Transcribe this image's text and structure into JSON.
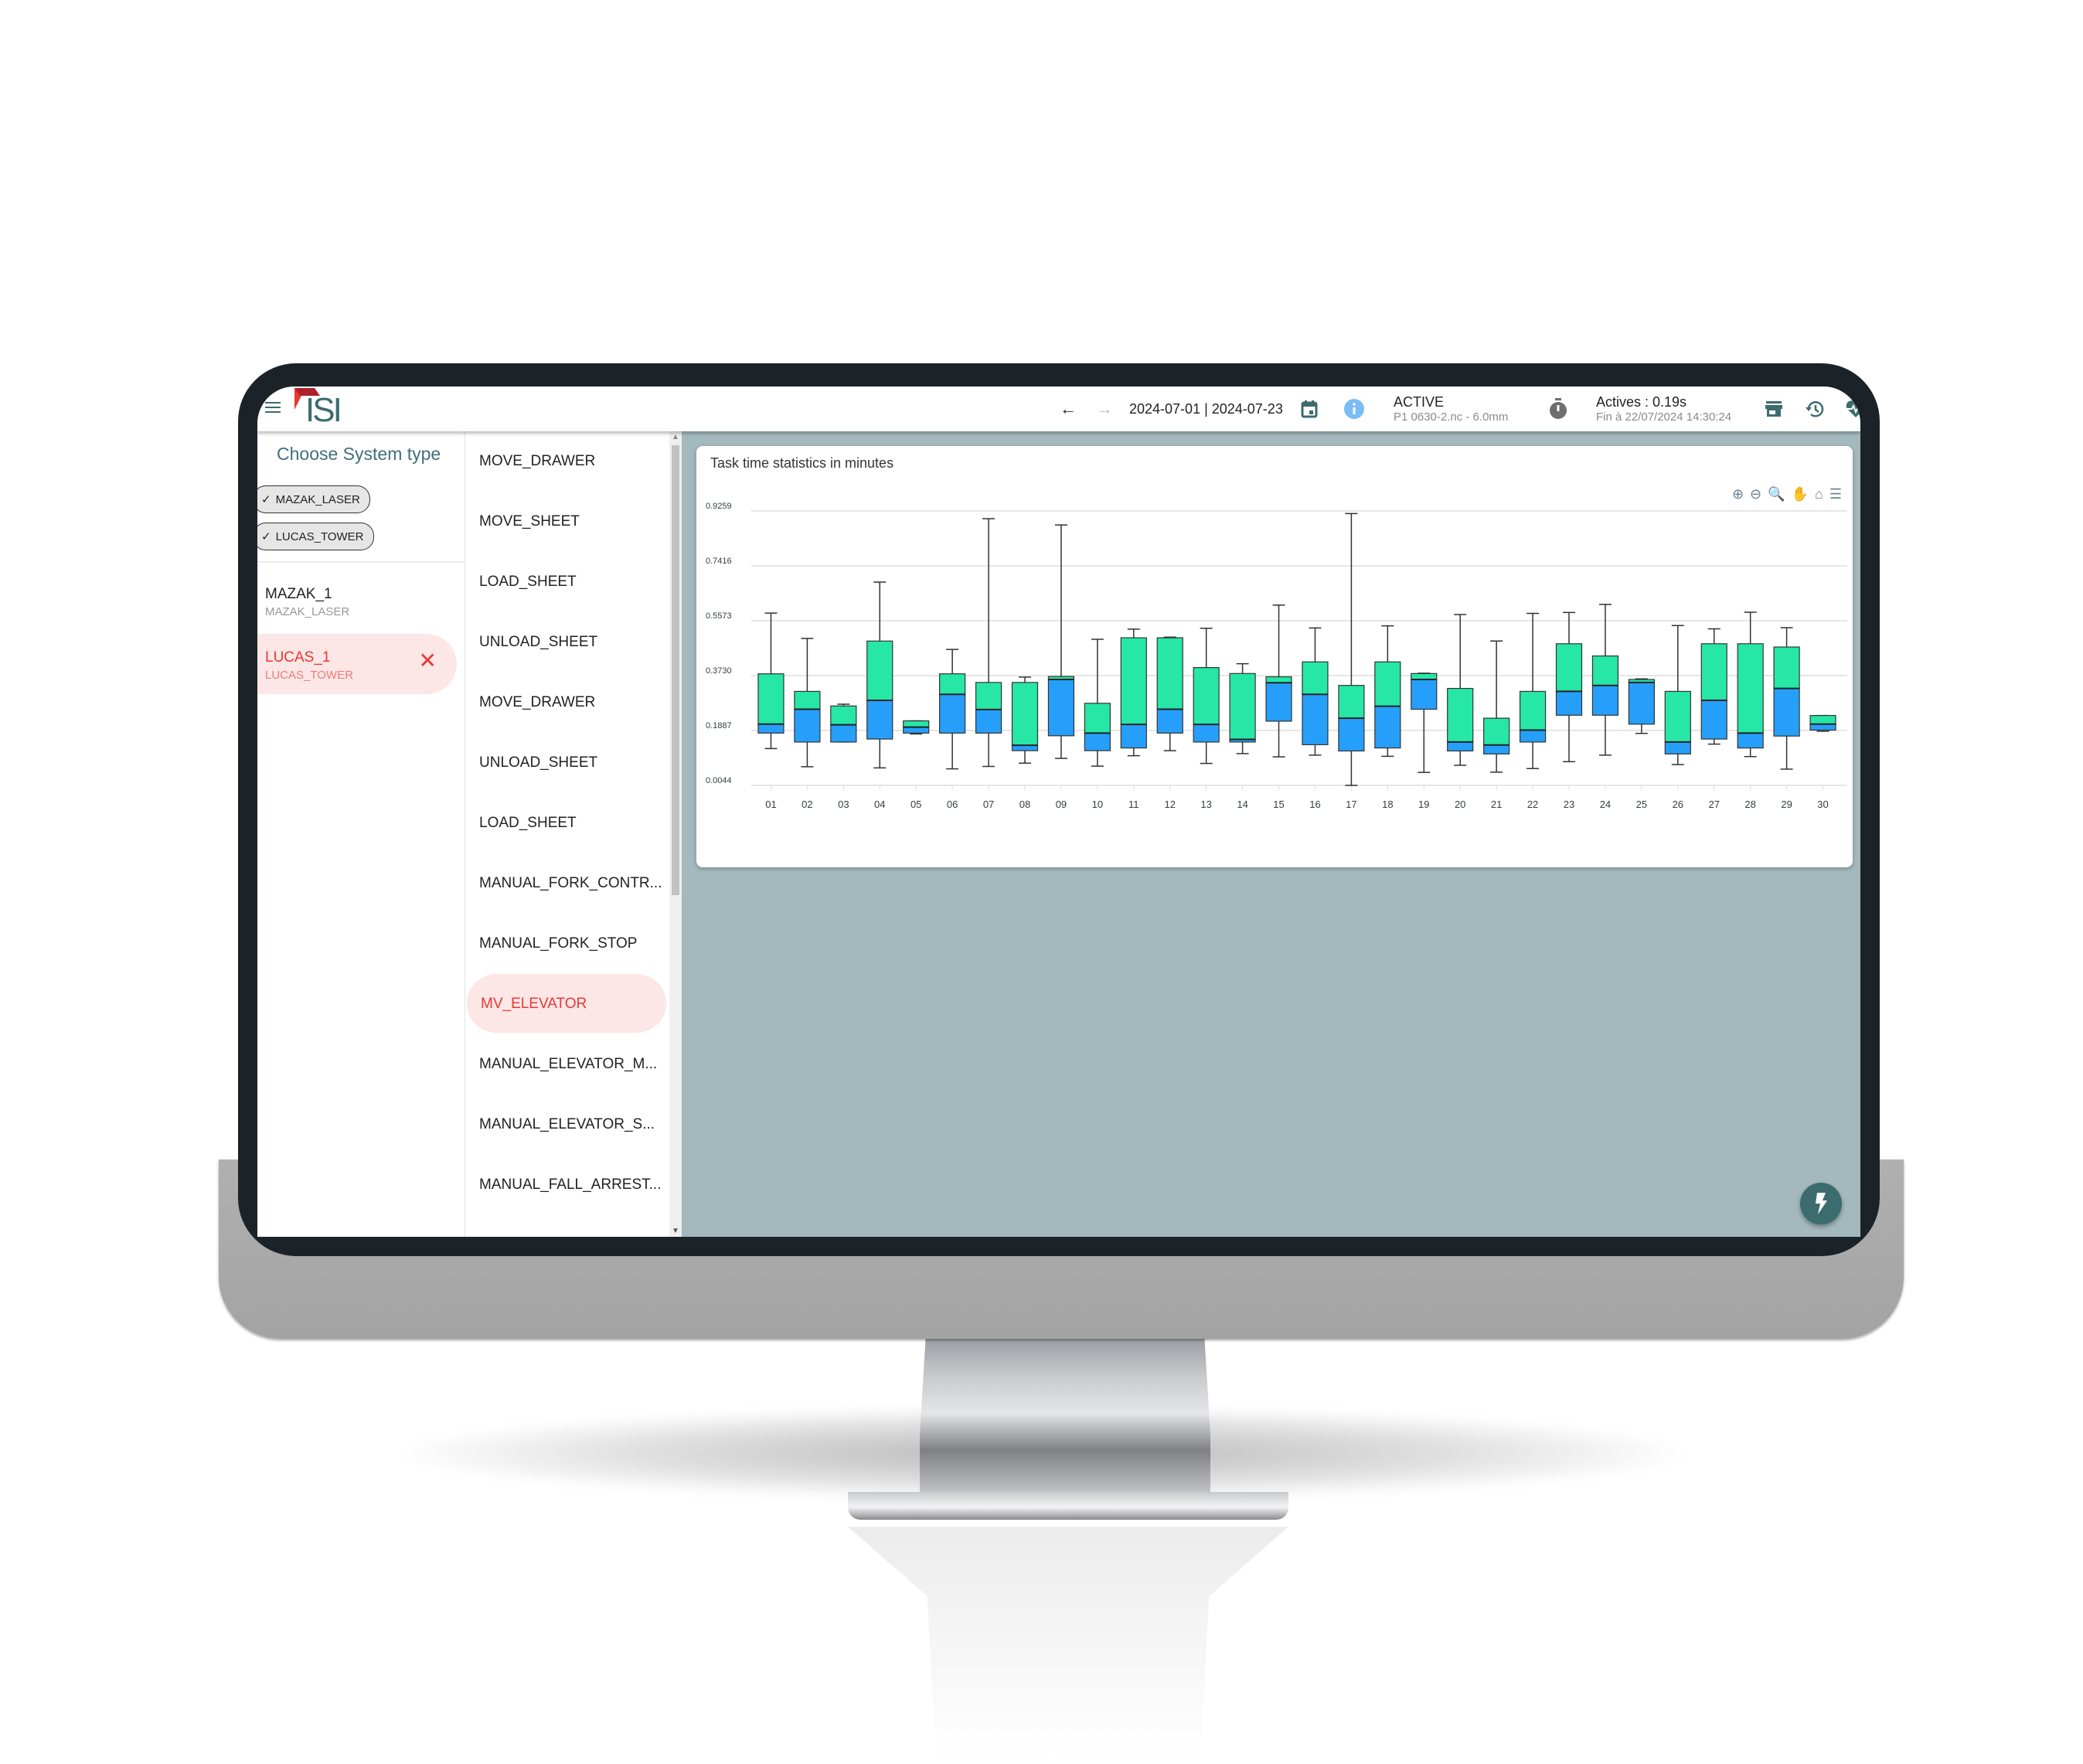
{
  "header": {
    "logo_text": "ISI",
    "date_range": "2024-07-01 | 2024-07-23",
    "status_title": "ACTIVE",
    "status_subtitle": "P1 0630-2.nc - 6.0mm",
    "timer_title": "Actives : 0.19s",
    "timer_subtitle": "Fin à 22/07/2024 14:30:24",
    "icons": [
      "menu-icon",
      "arrow-left-icon",
      "arrow-right-icon",
      "calendar-icon",
      "info-icon",
      "stopwatch-icon",
      "store-icon",
      "history-icon",
      "heart-pulse-icon"
    ]
  },
  "left_pane": {
    "title": "Choose System type",
    "chips": [
      {
        "label": "MAZAK_LASER",
        "checked": true
      },
      {
        "label": "LUCAS_TOWER",
        "checked": true
      }
    ],
    "systems": [
      {
        "name": "MAZAK_1",
        "type": "MAZAK_LASER",
        "selected": false
      },
      {
        "name": "LUCAS_1",
        "type": "LUCAS_TOWER",
        "selected": true
      }
    ]
  },
  "tasks": [
    {
      "label": "MOVE_DRAWER",
      "selected": false
    },
    {
      "label": "MOVE_SHEET",
      "selected": false
    },
    {
      "label": "LOAD_SHEET",
      "selected": false
    },
    {
      "label": "UNLOAD_SHEET",
      "selected": false
    },
    {
      "label": "MOVE_DRAWER",
      "selected": false
    },
    {
      "label": "UNLOAD_SHEET",
      "selected": false
    },
    {
      "label": "LOAD_SHEET",
      "selected": false
    },
    {
      "label": "MANUAL_FORK_CONTR...",
      "selected": false
    },
    {
      "label": "MANUAL_FORK_STOP",
      "selected": false
    },
    {
      "label": "MV_ELEVATOR",
      "selected": true
    },
    {
      "label": "MANUAL_ELEVATOR_M...",
      "selected": false
    },
    {
      "label": "MANUAL_ELEVATOR_S...",
      "selected": false
    },
    {
      "label": "MANUAL_FALL_ARREST...",
      "selected": false
    }
  ],
  "colors": {
    "accent": "#3d6c6f",
    "selected_bg": "#fce6e6",
    "selected_text": "#e53935",
    "box_upper": "#26e7a6",
    "box_lower": "#269ffb",
    "screen_bg": "#a3b9bd",
    "info": "#7cbcf5"
  },
  "chart_data": {
    "type": "boxplot",
    "title": "Task time statistics in minutes",
    "xlabel": "",
    "ylabel": "",
    "ylim": [
      0.0044,
      0.9259
    ],
    "yticks": [
      "0.9259",
      "0.7416",
      "0.5573",
      "0.3730",
      "0.1887",
      "0.0044"
    ],
    "ytick_values": [
      0.9259,
      0.7416,
      0.5573,
      0.373,
      0.1887,
      0.0044
    ],
    "grid": true,
    "legend": "none",
    "toolbar": [
      "zoom-in",
      "zoom-out",
      "zoom-selection",
      "pan",
      "reset-home",
      "menu"
    ],
    "categories": [
      "01",
      "02",
      "03",
      "04",
      "05",
      "06",
      "07",
      "08",
      "09",
      "10",
      "11",
      "12",
      "13",
      "14",
      "15",
      "16",
      "17",
      "18",
      "19",
      "20",
      "21",
      "22",
      "23",
      "24",
      "25",
      "26",
      "27",
      "28",
      "29",
      "30"
    ],
    "boxes": [
      {
        "min": 0.128,
        "q1": 0.18,
        "median": 0.21,
        "q3": 0.379,
        "max": 0.583
      },
      {
        "min": 0.067,
        "q1": 0.15,
        "median": 0.26,
        "q3": 0.32,
        "max": 0.498
      },
      {
        "min": 0.15,
        "q1": 0.15,
        "median": 0.208,
        "q3": 0.271,
        "max": 0.277
      },
      {
        "min": 0.063,
        "q1": 0.16,
        "median": 0.29,
        "q3": 0.489,
        "max": 0.687
      },
      {
        "min": 0.177,
        "q1": 0.18,
        "median": 0.2,
        "q3": 0.221,
        "max": 0.221
      },
      {
        "min": 0.06,
        "q1": 0.18,
        "median": 0.31,
        "q3": 0.379,
        "max": 0.461
      },
      {
        "min": 0.068,
        "q1": 0.18,
        "median": 0.259,
        "q3": 0.35,
        "max": 0.9
      },
      {
        "min": 0.079,
        "q1": 0.121,
        "median": 0.139,
        "q3": 0.35,
        "max": 0.368
      },
      {
        "min": 0.095,
        "q1": 0.171,
        "median": 0.36,
        "q3": 0.37,
        "max": 0.879
      },
      {
        "min": 0.069,
        "q1": 0.121,
        "median": 0.18,
        "q3": 0.28,
        "max": 0.495
      },
      {
        "min": 0.104,
        "q1": 0.13,
        "median": 0.209,
        "q3": 0.5,
        "max": 0.529
      },
      {
        "min": 0.121,
        "q1": 0.18,
        "median": 0.26,
        "q3": 0.5,
        "max": 0.502
      },
      {
        "min": 0.078,
        "q1": 0.15,
        "median": 0.209,
        "q3": 0.4,
        "max": 0.532
      },
      {
        "min": 0.111,
        "q1": 0.15,
        "median": 0.159,
        "q3": 0.38,
        "max": 0.413
      },
      {
        "min": 0.1,
        "q1": 0.22,
        "median": 0.349,
        "q3": 0.369,
        "max": 0.61
      },
      {
        "min": 0.106,
        "q1": 0.141,
        "median": 0.31,
        "q3": 0.419,
        "max": 0.533
      },
      {
        "min": 0.0044,
        "q1": 0.12,
        "median": 0.23,
        "q3": 0.34,
        "max": 0.917
      },
      {
        "min": 0.102,
        "q1": 0.13,
        "median": 0.27,
        "q3": 0.419,
        "max": 0.54
      },
      {
        "min": 0.048,
        "q1": 0.26,
        "median": 0.36,
        "q3": 0.38,
        "max": 0.381
      },
      {
        "min": 0.072,
        "q1": 0.12,
        "median": 0.15,
        "q3": 0.33,
        "max": 0.578
      },
      {
        "min": 0.049,
        "q1": 0.11,
        "median": 0.14,
        "q3": 0.23,
        "max": 0.489
      },
      {
        "min": 0.061,
        "q1": 0.15,
        "median": 0.19,
        "q3": 0.32,
        "max": 0.582
      },
      {
        "min": 0.084,
        "q1": 0.24,
        "median": 0.32,
        "q3": 0.48,
        "max": 0.585
      },
      {
        "min": 0.106,
        "q1": 0.24,
        "median": 0.34,
        "q3": 0.439,
        "max": 0.612
      },
      {
        "min": 0.179,
        "q1": 0.21,
        "median": 0.35,
        "q3": 0.36,
        "max": 0.362
      },
      {
        "min": 0.074,
        "q1": 0.11,
        "median": 0.15,
        "q3": 0.32,
        "max": 0.541
      },
      {
        "min": 0.143,
        "q1": 0.16,
        "median": 0.29,
        "q3": 0.48,
        "max": 0.53
      },
      {
        "min": 0.101,
        "q1": 0.13,
        "median": 0.18,
        "q3": 0.48,
        "max": 0.586
      },
      {
        "min": 0.059,
        "q1": 0.17,
        "median": 0.33,
        "q3": 0.469,
        "max": 0.534
      },
      {
        "min": 0.186,
        "q1": 0.19,
        "median": 0.21,
        "q3": 0.239,
        "max": 0.239
      }
    ]
  }
}
